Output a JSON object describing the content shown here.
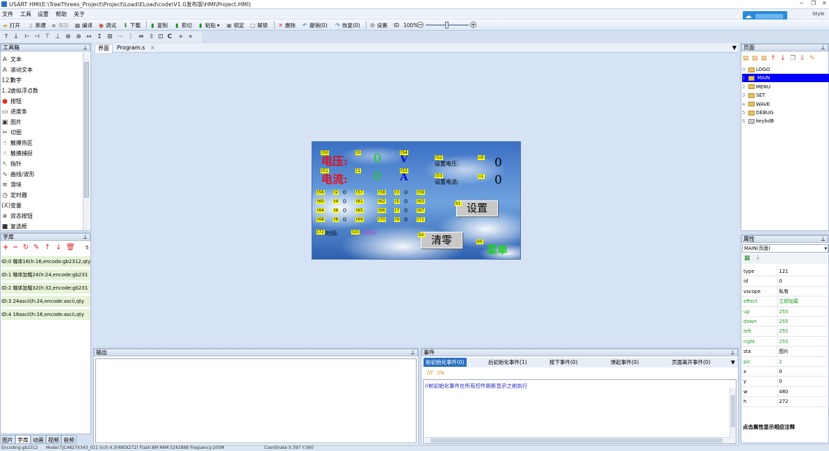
{
  "title": "USART HMI(E:\\TreeThrees_Project\\Project\\Load\\ELoad\\code\\V1.0发布版\\HMI\\Project.HMI)",
  "style_label": "Style",
  "menu": [
    "文件",
    "工具",
    "设置",
    "帮助",
    "关于"
  ],
  "toolbar": {
    "open": "打开",
    "new": "新建",
    "save": "保存",
    "compile": "编译",
    "debug": "调试",
    "download": "下载",
    "copy": "复制",
    "cut": "剪切",
    "paste": "粘贴",
    "lock": "锁定",
    "unlock": "解锁",
    "delete": "删除",
    "undo": "撤销(0)",
    "redo": "恢复(0)",
    "settings": "设置",
    "id": "ID",
    "zoom": "100%"
  },
  "toolbox": {
    "title": "工具箱",
    "items": [
      "文本",
      "滚动文本",
      "数字",
      "虚拟浮点数",
      "按钮",
      "进度条",
      "图片",
      "切图",
      "触摸热区",
      "触摸捕捉",
      "指针",
      "曲线/波形",
      "滑块",
      "定时器",
      "变量",
      "双态按钮",
      "复选框"
    ],
    "icons": [
      "A",
      "A",
      "123",
      "1.2",
      "●",
      "▭",
      "▣",
      "✂",
      "☝",
      "☝",
      "↖",
      "∿",
      "≡",
      "◷",
      "(X)",
      "⎈",
      "■"
    ]
  },
  "fontlib": {
    "title": "字库",
    "count": "5",
    "rows": [
      "ID:0  楷体16(h:16,encode:gb2312,qty",
      "ID:1  楷体加粗24(h:24,encode:gb231",
      "ID:2  楷体加粗32(h:32,encode:gb231",
      "ID:3  24ascii(h:24,encode:ascii,qty",
      "ID:4  16ascii(h:16,encode:ascii,qty"
    ]
  },
  "bottom_tabs": [
    "图片",
    "字库",
    "动画",
    "视频",
    "音频"
  ],
  "doc_tabs": [
    "界面",
    "Program.s"
  ],
  "hmi": {
    "voltage_label": "电压:",
    "current_label": "电流:",
    "voltage_value": "0",
    "current_value": "0",
    "unit_v": "V",
    "unit_a": "A",
    "set_voltage_label": "设置电压:",
    "set_current_label": "设置电流:",
    "set_voltage_value": "0",
    "set_current_value": "0",
    "setting_button": "设置",
    "clear_button": "清零",
    "menu_text": "菜单",
    "time_label": "时间:",
    "time_value": "0000",
    "tags": [
      "t50",
      "t0",
      "t54",
      "t52",
      "n0",
      "t51",
      "t1",
      "t55",
      "t53",
      "n1",
      "t56",
      "t2",
      "t57",
      "t58",
      "t3",
      "t59",
      "t60",
      "t4",
      "t61",
      "t62",
      "t5",
      "t63",
      "t64",
      "t6",
      "t65",
      "t66",
      "t7",
      "t67",
      "t68",
      "t8",
      "t69",
      "t70",
      "t9",
      "t71",
      "t72",
      "t10",
      "b1",
      "b2",
      "b0"
    ],
    "cell_value": "0"
  },
  "output_title": "输出",
  "events": {
    "title": "事件",
    "tabs": [
      "前初始化事件(0)",
      "后初始化事件(1)",
      "按下事件(0)",
      "弹起事件(0)",
      "页面离开事件(0)"
    ],
    "hint": "//前初始化事件在所有控件刷新显示之前执行"
  },
  "pages": {
    "title": "页面",
    "items": [
      {
        "num": "0",
        "name": "LOGO"
      },
      {
        "num": "1",
        "name": "MAIN"
      },
      {
        "num": "2",
        "name": "MENU"
      },
      {
        "num": "3",
        "name": "SET"
      },
      {
        "num": "4",
        "name": "WAVE"
      },
      {
        "num": "5",
        "name": "DEBUG"
      },
      {
        "num": "6",
        "name": "keybdB"
      }
    ]
  },
  "props": {
    "title": "属性",
    "selector": "MAIN(页面)",
    "rows": [
      {
        "k": "type",
        "v": "121",
        "green": false
      },
      {
        "k": "id",
        "v": "0",
        "green": false
      },
      {
        "k": "vscope",
        "v": "私有",
        "green": false
      },
      {
        "k": "effect",
        "v": "立即加载",
        "green": true
      },
      {
        "k": "up",
        "v": "255",
        "green": true
      },
      {
        "k": "down",
        "v": "255",
        "green": true
      },
      {
        "k": "left",
        "v": "255",
        "green": true
      },
      {
        "k": "right",
        "v": "255",
        "green": true
      },
      {
        "k": "sta",
        "v": "图片",
        "green": false
      },
      {
        "k": "pic",
        "v": "2",
        "green": true
      },
      {
        "k": "x",
        "v": "0",
        "green": false
      },
      {
        "k": "y",
        "v": "0",
        "green": false
      },
      {
        "k": "w",
        "v": "480",
        "green": false
      },
      {
        "k": "h",
        "v": "272",
        "green": false
      }
    ],
    "footer": "点击属性显示相应注释"
  },
  "status": {
    "encoding": "Encoding:gb2312",
    "model": "Model:TJC4827X343_011   inch:4.3(480X272) Flash:8M RAM:524288B Frequency:200M",
    "coord": "Coordinate X:397  Y:360"
  },
  "colors": {
    "accent": "#2a8bd8",
    "selected": "#0000ff",
    "green_prop": "#1a9a1a"
  }
}
